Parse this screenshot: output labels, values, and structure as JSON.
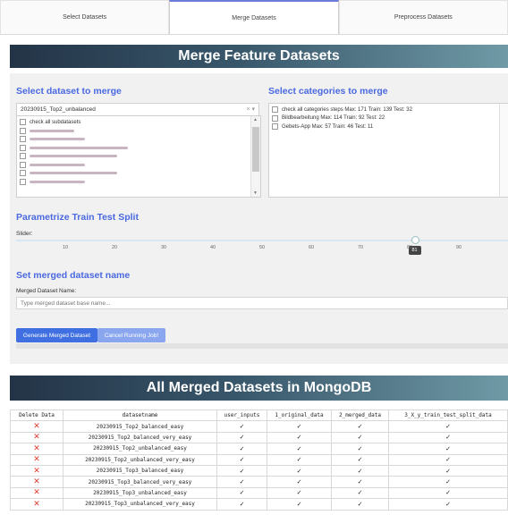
{
  "tabs": [
    "Select Datasets",
    "Merge Datasets",
    "Preprocess Datasets"
  ],
  "merge_banner": "Merge Feature Datasets",
  "select_dataset": {
    "title": "Select dataset to merge",
    "selected": "20230915_Top2_unbalanced",
    "options": [
      "check all subdatasets",
      "permissions_features_dataset",
      "sensors_dataset",
      "apis_third_party_sql_call_dataset",
      "activities_dataset",
      "intents_dataset",
      "nlmo_total_dataset",
      "apis_android_sql_call_dataset"
    ]
  },
  "select_categories": {
    "title": "Select categories to merge",
    "items": [
      "check all categories steps Max: 171 Train: 139 Test: 32",
      "Bildbearbeitung Max: 114 Train: 92 Test: 22",
      "Gebets-App Max: 57 Train: 46 Test: 11"
    ]
  },
  "split": {
    "title": "Parametrize Train Test Split",
    "slider_label": "Slider:",
    "ticks": [
      "10",
      "20",
      "30",
      "40",
      "50",
      "60",
      "70",
      "80",
      "90"
    ],
    "value": 81,
    "value_label": "81"
  },
  "name_section": {
    "title": "Set merged dataset name",
    "label": "Merged Dataset Name:",
    "placeholder": "Type merged dataset base name..."
  },
  "buttons": {
    "generate": "Generate Merged Dataset",
    "cancel": "Cancel Running Job!"
  },
  "mongo_banner": "All Merged Datasets in MongoDB",
  "table": {
    "headers": [
      "Delete Data",
      "datasetname",
      "user_inputs",
      "1_original_data",
      "2_merged_data",
      "3_X_y_train_test_split_data"
    ],
    "delete_symbol": "✕",
    "check_symbol": "✓",
    "rows": [
      "20230915_Top2_balanced_easy",
      "20230915_Top2_balanced_very_easy",
      "20230915_Top2_unbalanced_easy",
      "20230915_Top2_unbalanced_very_easy",
      "20230915_Top3_balanced_easy",
      "20230915_Top3_balanced_very_easy",
      "20230915_Top3_unbalanced_easy",
      "20230915_Top3_unbalanced_very_easy"
    ]
  },
  "colors": {
    "accent": "#4a69e0",
    "button": "#3f6fe0",
    "button_disabled": "#8aa6ef",
    "delete": "#e03b2f"
  }
}
